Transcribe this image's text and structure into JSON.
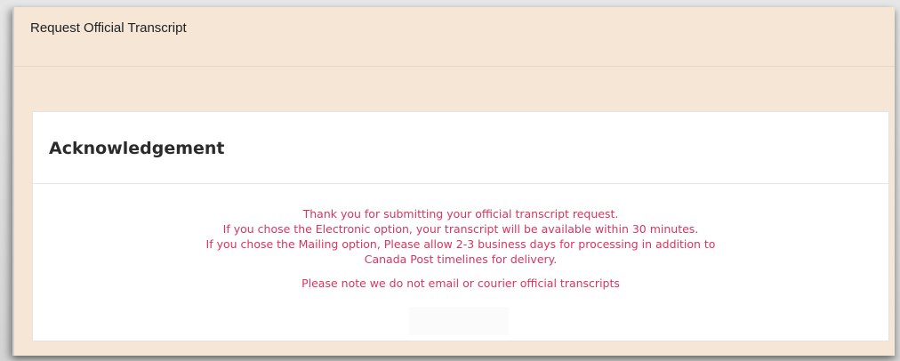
{
  "page": {
    "title": "Request Official Transcript"
  },
  "card": {
    "title": "Acknowledgement",
    "messages": [
      "Thank you for submitting your official transcript request.",
      "If you chose the Electronic option, your transcript will be available within 30 minutes.",
      "If you chose the Mailing option, Please allow 2-3 business days for processing in addition to",
      "Canada Post timelines for delivery."
    ],
    "note": "Please note we do not email or courier official transcripts"
  },
  "colors": {
    "panel_background": "#f5e6d6",
    "message_text": "#d6365f",
    "card_background": "#ffffff"
  }
}
